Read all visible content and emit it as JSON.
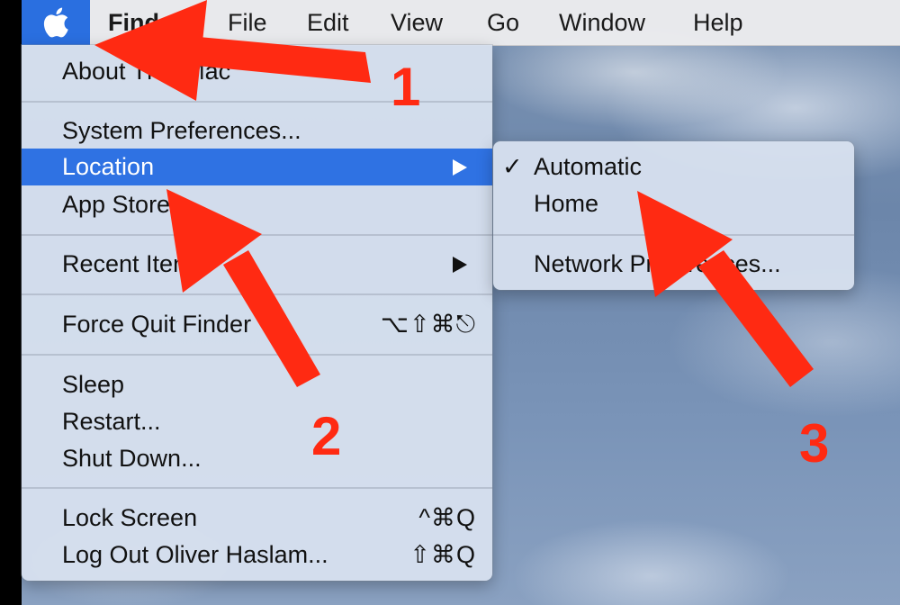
{
  "menubar": {
    "apple_icon": "apple-logo-icon",
    "items": [
      "Finder",
      "File",
      "Edit",
      "View",
      "Go",
      "Window",
      "Help"
    ]
  },
  "apple_menu": {
    "about": "About This Mac",
    "system_preferences": "System Preferences...",
    "location": "Location",
    "app_store": "App Store...",
    "recent_items": "Recent Items",
    "force_quit": "Force Quit Finder",
    "force_quit_shortcut": "⌥⇧⌘⎋",
    "sleep": "Sleep",
    "restart": "Restart...",
    "shut_down": "Shut Down...",
    "lock_screen": "Lock Screen",
    "lock_screen_shortcut": "^⌘Q",
    "log_out": "Log Out Oliver Haslam...",
    "log_out_shortcut": "⇧⌘Q"
  },
  "location_submenu": {
    "checkmark": "✓",
    "automatic": "Automatic",
    "home": "Home",
    "network_preferences": "Network Preferences..."
  },
  "annotations": {
    "step1": "1",
    "step2": "2",
    "step3": "3",
    "color": "#ff2a12"
  },
  "colors": {
    "highlight": "#2f72e3",
    "menubar_apple_bg": "#2a6fe0"
  }
}
